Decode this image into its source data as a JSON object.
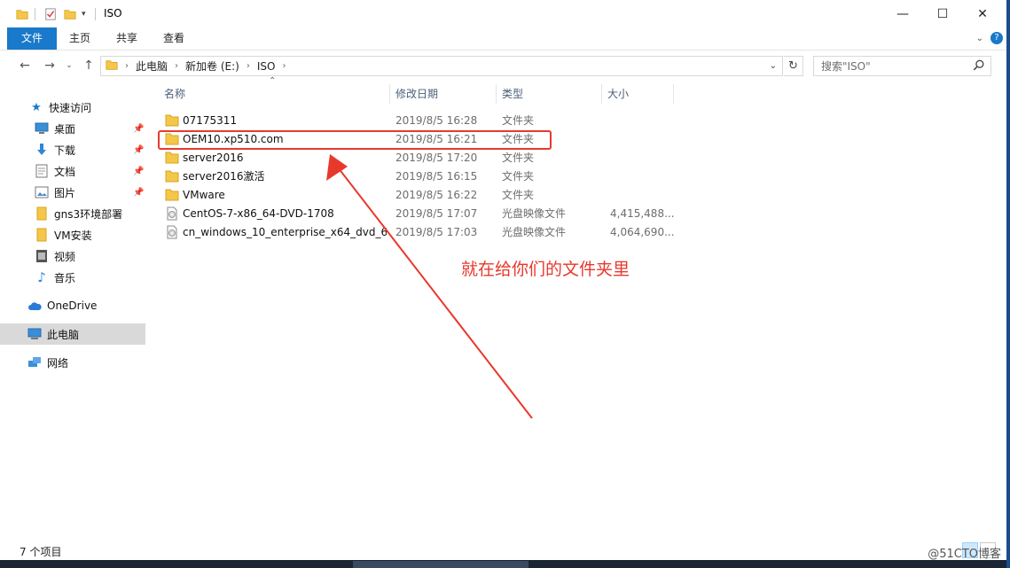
{
  "window": {
    "title": "ISO"
  },
  "window_controls": {
    "minimize": "—",
    "maximize": "☐",
    "close": "✕"
  },
  "ribbon": {
    "tabs": [
      "文件",
      "主页",
      "共享",
      "查看"
    ],
    "accent_color": "#1979ca"
  },
  "address": {
    "crumbs": [
      "此电脑",
      "新加卷 (E:)",
      "ISO"
    ],
    "search_placeholder": "搜索\"ISO\""
  },
  "sidebar": {
    "quick_access": "快速访问",
    "items": [
      {
        "label": "桌面",
        "icon": "desktop-icon",
        "pinned": true
      },
      {
        "label": "下载",
        "icon": "download-icon",
        "pinned": true
      },
      {
        "label": "文档",
        "icon": "document-icon",
        "pinned": true
      },
      {
        "label": "图片",
        "icon": "picture-icon",
        "pinned": true
      },
      {
        "label": "gns3环境部署",
        "icon": "folder-icon",
        "pinned": false
      },
      {
        "label": "VM安装",
        "icon": "folder-icon",
        "pinned": false
      },
      {
        "label": "视频",
        "icon": "video-icon",
        "pinned": false
      },
      {
        "label": "音乐",
        "icon": "music-icon",
        "pinned": false
      }
    ],
    "onedrive": "OneDrive",
    "this_pc": "此电脑",
    "network": "网络"
  },
  "columns": {
    "name": "名称",
    "date": "修改日期",
    "type": "类型",
    "size": "大小"
  },
  "files": [
    {
      "name": "07175311",
      "date": "2019/8/5 16:28",
      "type": "文件夹",
      "size": "",
      "icon": "folder-icon"
    },
    {
      "name": "OEM10.xp510.com",
      "date": "2019/8/5 16:21",
      "type": "文件夹",
      "size": "",
      "icon": "folder-icon"
    },
    {
      "name": "server2016",
      "date": "2019/8/5 17:20",
      "type": "文件夹",
      "size": "",
      "icon": "folder-icon"
    },
    {
      "name": "server2016激活",
      "date": "2019/8/5 16:15",
      "type": "文件夹",
      "size": "",
      "icon": "folder-icon"
    },
    {
      "name": "VMware",
      "date": "2019/8/5 16:22",
      "type": "文件夹",
      "size": "",
      "icon": "folder-icon"
    },
    {
      "name": "CentOS-7-x86_64-DVD-1708",
      "date": "2019/8/5 17:07",
      "type": "光盘映像文件",
      "size": "4,415,488...",
      "icon": "disc-image-icon"
    },
    {
      "name": "cn_windows_10_enterprise_x64_dvd_6...",
      "date": "2019/8/5 17:03",
      "type": "光盘映像文件",
      "size": "4,064,690...",
      "icon": "disc-image-icon"
    }
  ],
  "annotation": {
    "text": "就在给你们的文件夹里",
    "color": "#e8382c"
  },
  "status": {
    "count": "7 个项目"
  },
  "watermark": "@51CTO博客"
}
